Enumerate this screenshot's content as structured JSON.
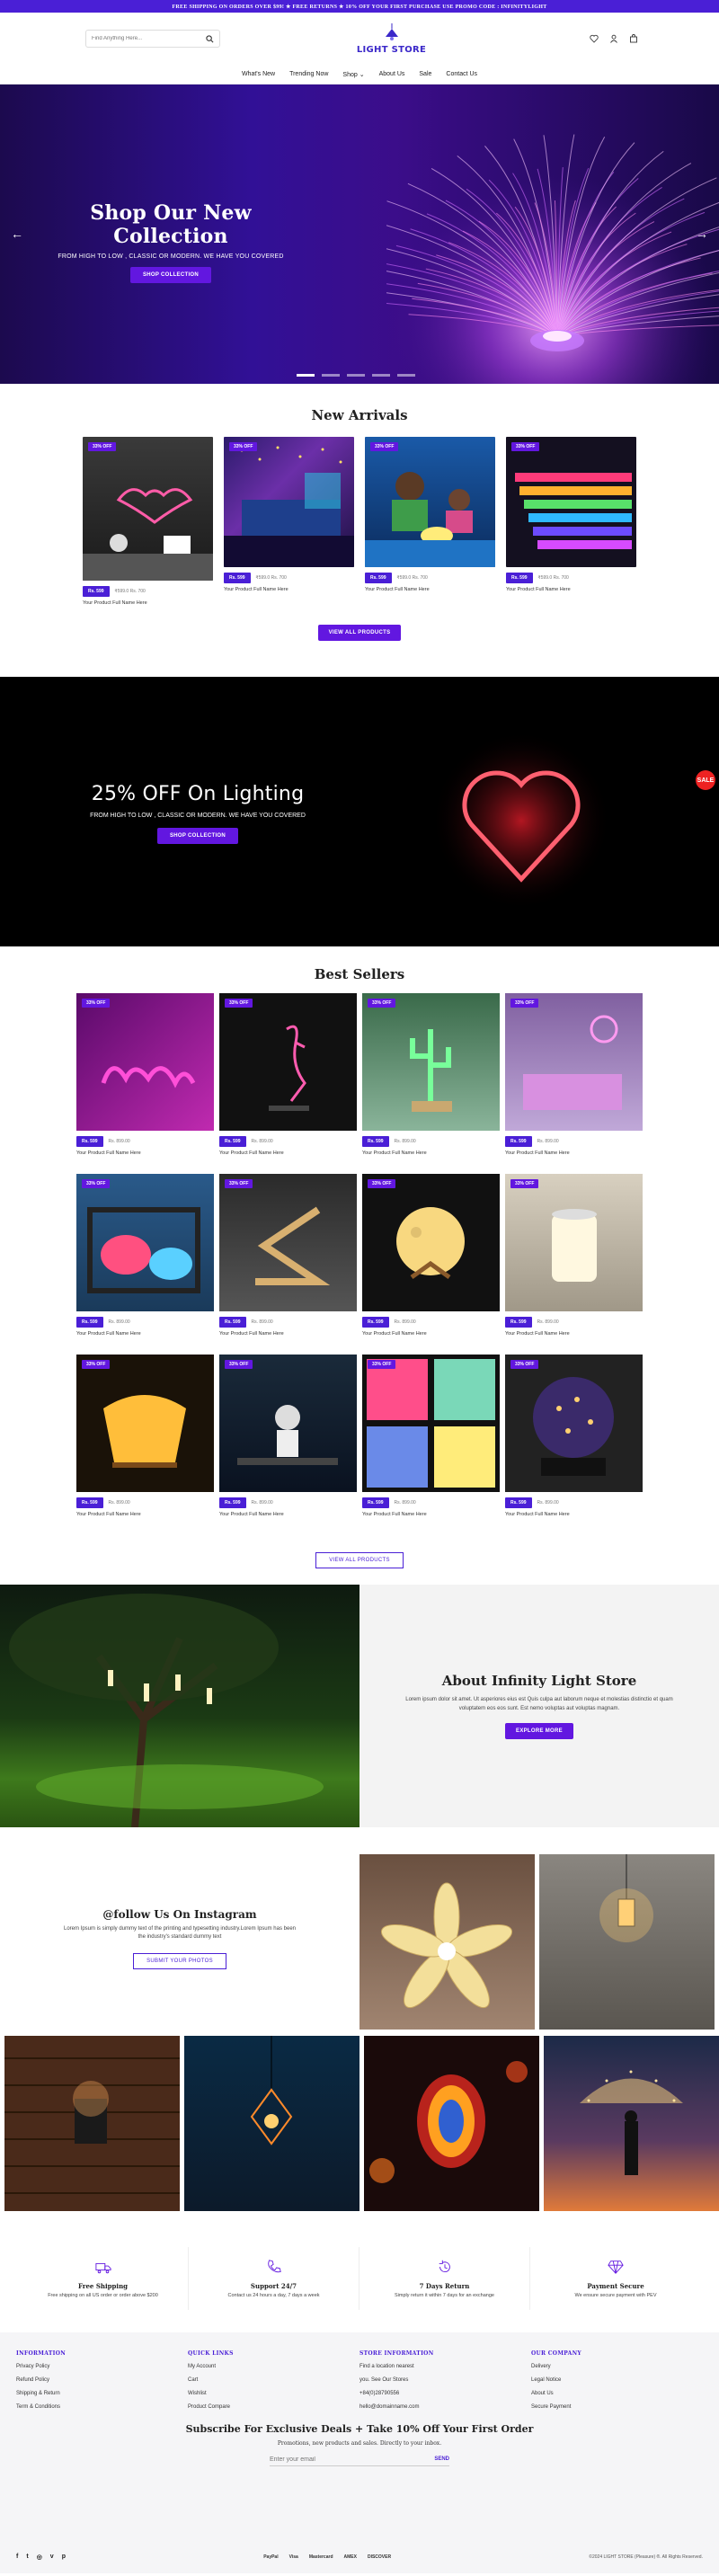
{
  "topbar": {
    "text": "FREE SHIPPING ON ORDERS OVER $99! ★ FREE RETURNS ★ 10% OFF YOUR FIRST PURCHASE USE PROMO CODE : INFINITYLIGHT"
  },
  "header": {
    "search_placeholder": "Find Anything Here...",
    "logo": "LIGHT STORE"
  },
  "nav": [
    "What's New",
    "Trending Now",
    "Shop",
    "About Us",
    "Sale",
    "Contact Us"
  ],
  "hero": {
    "title": "Shop Our New Collection",
    "subtitle": "FROM HIGH TO LOW , CLASSIC OR MODERN. WE HAVE YOU COVERED",
    "button": "SHOP COLLECTION",
    "prev": "←",
    "next": "→"
  },
  "new_arrivals": {
    "title": "New Arrivals",
    "button": "VIEW ALL PRODUCTS",
    "items": [
      {
        "badge": "33% OFF",
        "price": "Rs. 599",
        "old": "₹599.0 Rs. 700",
        "name": "Your Product Full Name Here"
      },
      {
        "badge": "33% OFF",
        "price": "Rs. 599",
        "old": "₹599.0 Rs. 700",
        "name": "Your Product Full Name Here"
      },
      {
        "badge": "33% OFF",
        "price": "Rs. 599",
        "old": "₹599.0 Rs. 700",
        "name": "Your Product Full Name Here"
      },
      {
        "badge": "33% OFF",
        "price": "Rs. 599",
        "old": "₹599.0 Rs. 700",
        "name": "Your Product Full Name Here"
      }
    ]
  },
  "promo": {
    "title": "25% OFF On Lighting",
    "subtitle": "FROM HIGH TO LOW , CLASSIC OR MODERN. WE HAVE YOU COVERED",
    "button": "SHOP COLLECTION",
    "sale": "SALE"
  },
  "best_sellers": {
    "title": "Best Sellers",
    "button": "VIEW ALL PRODUCTS",
    "items": [
      {
        "badge": "33% OFF",
        "price": "Rs. 599",
        "old": "Rs. 899.00",
        "name": "Your Product Full Name Here"
      },
      {
        "badge": "33% OFF",
        "price": "Rs. 599",
        "old": "Rs. 899.00",
        "name": "Your Product Full Name Here"
      },
      {
        "badge": "33% OFF",
        "price": "Rs. 599",
        "old": "Rs. 899.00",
        "name": "Your Product Full Name Here"
      },
      {
        "badge": "33% OFF",
        "price": "Rs. 599",
        "old": "Rs. 899.00",
        "name": "Your Product Full Name Here"
      },
      {
        "badge": "33% OFF",
        "price": "Rs. 599",
        "old": "Rs. 899.00",
        "name": "Your Product Full Name Here"
      },
      {
        "badge": "33% OFF",
        "price": "Rs. 599",
        "old": "Rs. 899.00",
        "name": "Your Product Full Name Here"
      },
      {
        "badge": "33% OFF",
        "price": "Rs. 599",
        "old": "Rs. 899.00",
        "name": "Your Product Full Name Here"
      },
      {
        "badge": "33% OFF",
        "price": "Rs. 599",
        "old": "Rs. 899.00",
        "name": "Your Product Full Name Here"
      },
      {
        "badge": "33% OFF",
        "price": "Rs. 599",
        "old": "Rs. 899.00",
        "name": "Your Product Full Name Here"
      },
      {
        "badge": "33% OFF",
        "price": "Rs. 599",
        "old": "Rs. 899.00",
        "name": "Your Product Full Name Here"
      },
      {
        "badge": "33% OFF",
        "price": "Rs. 599",
        "old": "Rs. 899.00",
        "name": "Your Product Full Name Here"
      },
      {
        "badge": "33% OFF",
        "price": "Rs. 599",
        "old": "Rs. 899.00",
        "name": "Your Product Full Name Here"
      }
    ]
  },
  "about": {
    "title": "About Infinity Light Store",
    "body": "Lorem ipsum dolor sit amet. Ut asperiores eius est Quis culpa aut laborum neque et molestias distinctio et quam voluptatem eos eos sunt. Est nemo voluptas aut voluptas magnam.",
    "button": "EXPLORE MORE"
  },
  "instagram": {
    "title": "@follow Us On Instagram",
    "body": "Lorem Ipsum is simply dummy text of the printing and typesetting industry.Lorem Ipsum has been the industry's standard dummy text",
    "button": "SUBMIT YOUR PHOTOS"
  },
  "features": [
    {
      "icon": "truck-icon",
      "title": "Free Shipping",
      "sub": "Free shipping on all US order or order above $200"
    },
    {
      "icon": "phone-icon",
      "title": "Support 24/7",
      "sub": "Contact us 24 hours a day, 7 days a week"
    },
    {
      "icon": "return-icon",
      "title": "7 Days Return",
      "sub": "Simply return it within 7 days for an exchange"
    },
    {
      "icon": "diamond-icon",
      "title": "Payment Secure",
      "sub": "We ensure secure payment with PEV"
    }
  ],
  "footer": {
    "cols": [
      {
        "head": "INFORMATION",
        "links": [
          "Privacy Policy",
          "Refund Policy",
          "Shipping & Return",
          "Term & Conditions"
        ]
      },
      {
        "head": "QUICK LINKS",
        "links": [
          "My Account",
          "Cart",
          "Wishlist",
          "Product Compare"
        ]
      },
      {
        "head": "STORE INFORMATION",
        "links": [
          "Find a location nearest",
          "you. See Our Stores",
          "+84(0)28790556",
          "hello@domainname.com"
        ]
      },
      {
        "head": "OUR COMPANY",
        "links": [
          "Delivery",
          "Legal Notice",
          "About Us",
          "Secure Payment"
        ]
      }
    ],
    "subscribe_title": "Subscribe For Exclusive Deals + Take 10% Off Your First Order",
    "subscribe_text": "Promotions, new products and sales. Directly to your inbox.",
    "email_placeholder": "Enter your email",
    "send": "SEND",
    "social": [
      "f",
      "t",
      "◎",
      "v",
      "p"
    ],
    "payments": [
      "PayPal",
      "Visa",
      "Mastercard",
      "AMEX",
      "DISCOVER"
    ],
    "copyright": "©2024 LIGHT STORE (Pleasure) ®. All Rights Reserved."
  }
}
